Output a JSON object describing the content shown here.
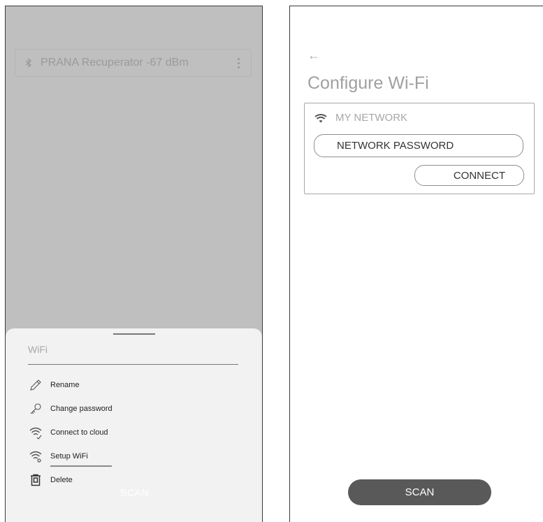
{
  "left_screen": {
    "device_row": {
      "icon": "bluetooth-icon",
      "name": "PRANA Recuperator -67 dBm",
      "menu_icon": "kebab-menu-icon"
    },
    "bottom_sheet": {
      "title": "WiFi",
      "items": [
        {
          "icon": "pencil-icon",
          "label": "Rename"
        },
        {
          "icon": "key-icon",
          "label": "Change password"
        },
        {
          "icon": "wifi-cloud-icon",
          "label": "Connect to cloud"
        },
        {
          "icon": "wifi-gear-icon",
          "label": "Setup WiFi"
        },
        {
          "icon": "trash-icon",
          "label": "Delete"
        }
      ],
      "scan_label": "SCAN"
    }
  },
  "right_screen": {
    "back_icon": "back-arrow-icon",
    "back_glyph": "←",
    "title": "Configure Wi-Fi",
    "network": {
      "icon": "wifi-icon",
      "name": "MY NETWORK",
      "password_placeholder": "NETWORK PASSWORD",
      "connect_label": "CONNECT"
    },
    "scan_label": "SCAN"
  },
  "colors": {
    "overlay_gray": "#bfbfbf",
    "sheet_bg": "#f2f2f2",
    "scan_button": "#595959",
    "muted_text": "#a8a8a8"
  }
}
